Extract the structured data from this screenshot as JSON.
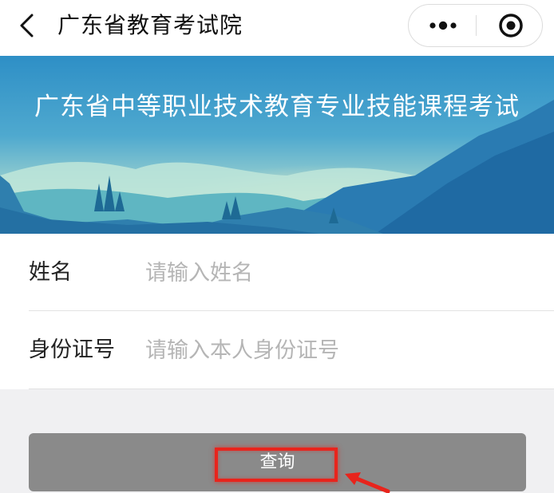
{
  "navbar": {
    "title": "广东省教育考试院",
    "back_icon": "chevron-left-icon",
    "more_icon": "more-dots-icon",
    "close_icon": "target-close-icon"
  },
  "banner": {
    "title": "广东省中等职业技术教育专业技能课程考试"
  },
  "form": {
    "name_label": "姓名",
    "name_placeholder": "请输入姓名",
    "name_value": "",
    "id_label": "身份证号",
    "id_placeholder": "请输入本人身份证号",
    "id_value": ""
  },
  "actions": {
    "query_label": "查询"
  },
  "colors": {
    "banner_sky": "#2a8fc4",
    "button_bg": "#8a8a8a",
    "highlight": "#e8241c"
  }
}
